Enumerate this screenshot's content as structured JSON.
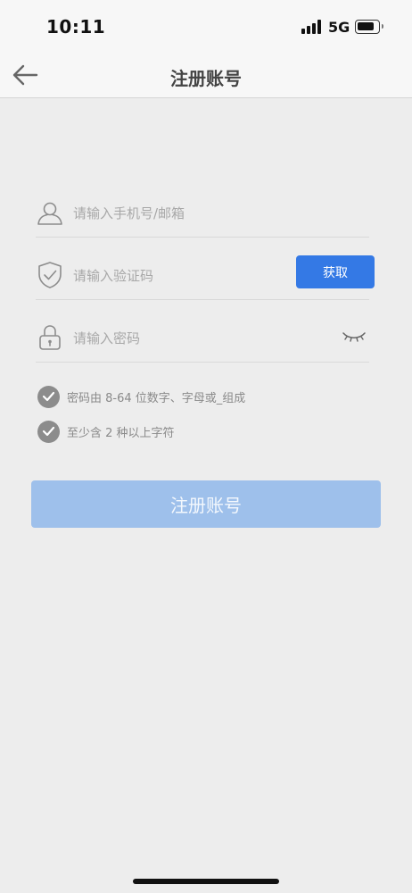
{
  "status_bar": {
    "time": "10:11",
    "network": "5G"
  },
  "nav": {
    "title": "注册账号"
  },
  "form": {
    "account_placeholder": "请输入手机号/邮箱",
    "code_placeholder": "请输入验证码",
    "get_code_label": "获取",
    "password_placeholder": "请输入密码"
  },
  "rules": [
    {
      "text": "密码由 8-64 位数字、字母或_组成"
    },
    {
      "text": "至少含 2 种以上字符"
    }
  ],
  "submit": {
    "label": "注册账号"
  },
  "colors": {
    "primary": "#3479e5",
    "disabled_primary": "#9ec0eb",
    "background": "#ededed"
  }
}
